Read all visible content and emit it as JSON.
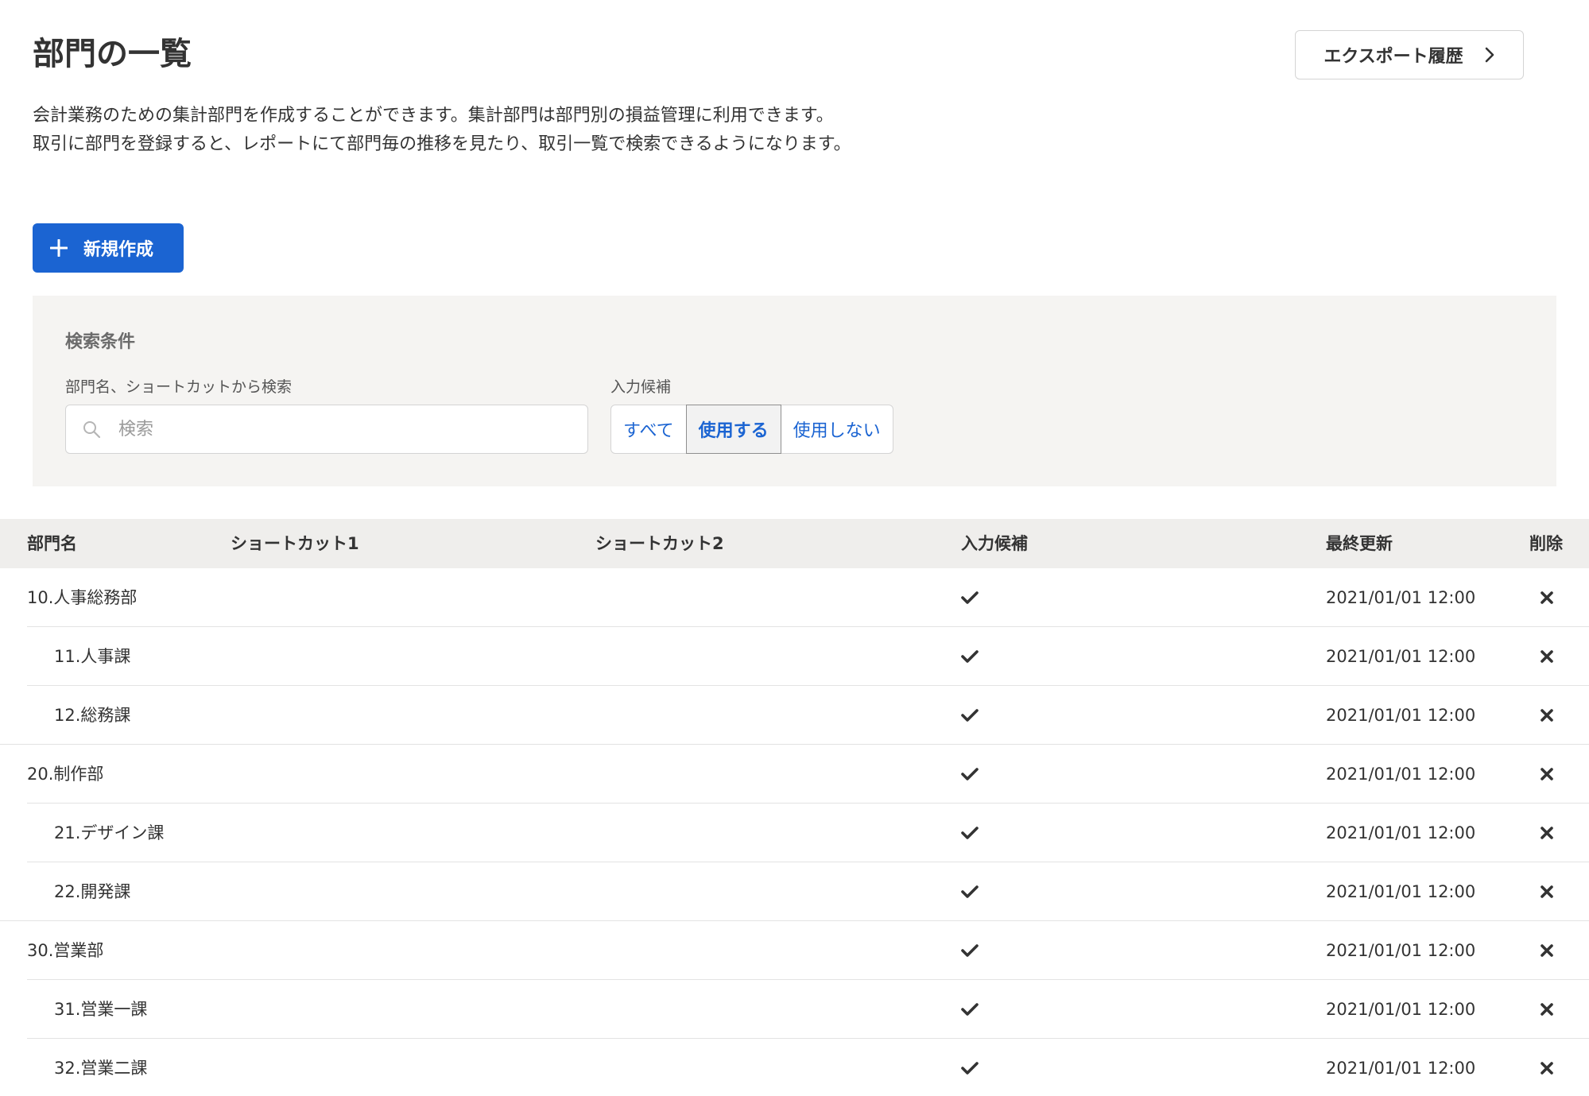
{
  "header": {
    "title": "部門の一覧",
    "export_label": "エクスポート履歴",
    "description_line1": "会計業務のための集計部門を作成することができます。集計部門は部門別の損益管理に利用できます。",
    "description_line2": "取引に部門を登録すると、レポートにて部門毎の推移を見たり、取引一覧で検索できるようになります。"
  },
  "new_button_label": "新規作成",
  "search": {
    "heading": "検索条件",
    "name_label": "部門名、ショートカットから検索",
    "placeholder": "検索",
    "suggest_label": "入力候補",
    "options": [
      "すべて",
      "使用する",
      "使用しない"
    ],
    "selected": "使用する"
  },
  "table": {
    "columns": {
      "name": "部門名",
      "shortcut1": "ショートカット1",
      "shortcut2": "ショートカット2",
      "suggest": "入力候補",
      "updated": "最終更新",
      "delete": "削除"
    },
    "rows": [
      {
        "name": "10.人事総務部",
        "level": 0,
        "shortcut1": "",
        "shortcut2": "",
        "suggest": true,
        "updated": "2021/01/01 12:00"
      },
      {
        "name": "11.人事課",
        "level": 1,
        "shortcut1": "",
        "shortcut2": "",
        "suggest": true,
        "updated": "2021/01/01 12:00"
      },
      {
        "name": "12.総務課",
        "level": 1,
        "shortcut1": "",
        "shortcut2": "",
        "suggest": true,
        "updated": "2021/01/01 12:00"
      },
      {
        "name": "20.制作部",
        "level": 0,
        "shortcut1": "",
        "shortcut2": "",
        "suggest": true,
        "updated": "2021/01/01 12:00"
      },
      {
        "name": "21.デザイン課",
        "level": 1,
        "shortcut1": "",
        "shortcut2": "",
        "suggest": true,
        "updated": "2021/01/01 12:00"
      },
      {
        "name": "22.開発課",
        "level": 1,
        "shortcut1": "",
        "shortcut2": "",
        "suggest": true,
        "updated": "2021/01/01 12:00"
      },
      {
        "name": "30.営業部",
        "level": 0,
        "shortcut1": "",
        "shortcut2": "",
        "suggest": true,
        "updated": "2021/01/01 12:00"
      },
      {
        "name": "31.営業一課",
        "level": 1,
        "shortcut1": "",
        "shortcut2": "",
        "suggest": true,
        "updated": "2021/01/01 12:00"
      },
      {
        "name": "32.営業二課",
        "level": 1,
        "shortcut1": "",
        "shortcut2": "",
        "suggest": true,
        "updated": "2021/01/01 12:00"
      }
    ]
  },
  "colors": {
    "primary": "#1b64d2",
    "panel_bg": "#f5f4f2",
    "table_header_bg": "#efeeec",
    "text": "#333333"
  },
  "icons": {
    "export": "chevron-right-icon",
    "new": "plus-icon",
    "search": "search-icon",
    "suggest": "check-icon",
    "delete": "close-icon"
  }
}
